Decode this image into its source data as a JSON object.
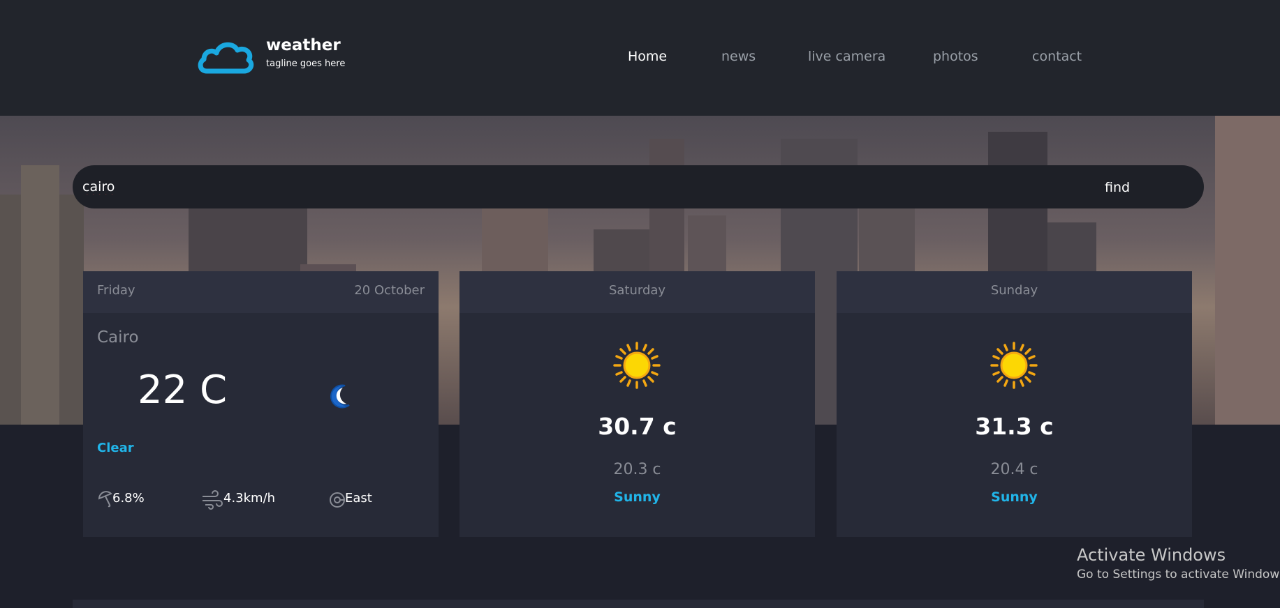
{
  "brand": {
    "title": "weather",
    "tagline": "tagline goes here"
  },
  "nav": {
    "items": [
      "Home",
      "news",
      "live camera",
      "photos",
      "contact"
    ],
    "active": "Home"
  },
  "search": {
    "value": "cairo",
    "button_label": "find"
  },
  "today": {
    "day": "Friday",
    "date": "20 October",
    "city": "Cairo",
    "temperature": "22 C",
    "condition": "Clear",
    "icon": "moon-icon",
    "rain": "6.8%",
    "wind_speed": "4.3km/h",
    "wind_direction": "East"
  },
  "forecast": [
    {
      "day": "Saturday",
      "icon": "sun-icon",
      "max": "30.7 c",
      "min": "20.3 c",
      "condition": "Sunny"
    },
    {
      "day": "Sunday",
      "icon": "sun-icon",
      "max": "31.3 c",
      "min": "20.4 c",
      "condition": "Sunny"
    }
  ],
  "watermark": {
    "line1": "Activate Windows",
    "line2": "Go to Settings to activate Windows."
  },
  "colors": {
    "accent": "#21b5e9",
    "header_bg": "#22252c",
    "card_bg": "#272a37",
    "card_head_bg": "#2e3140"
  }
}
